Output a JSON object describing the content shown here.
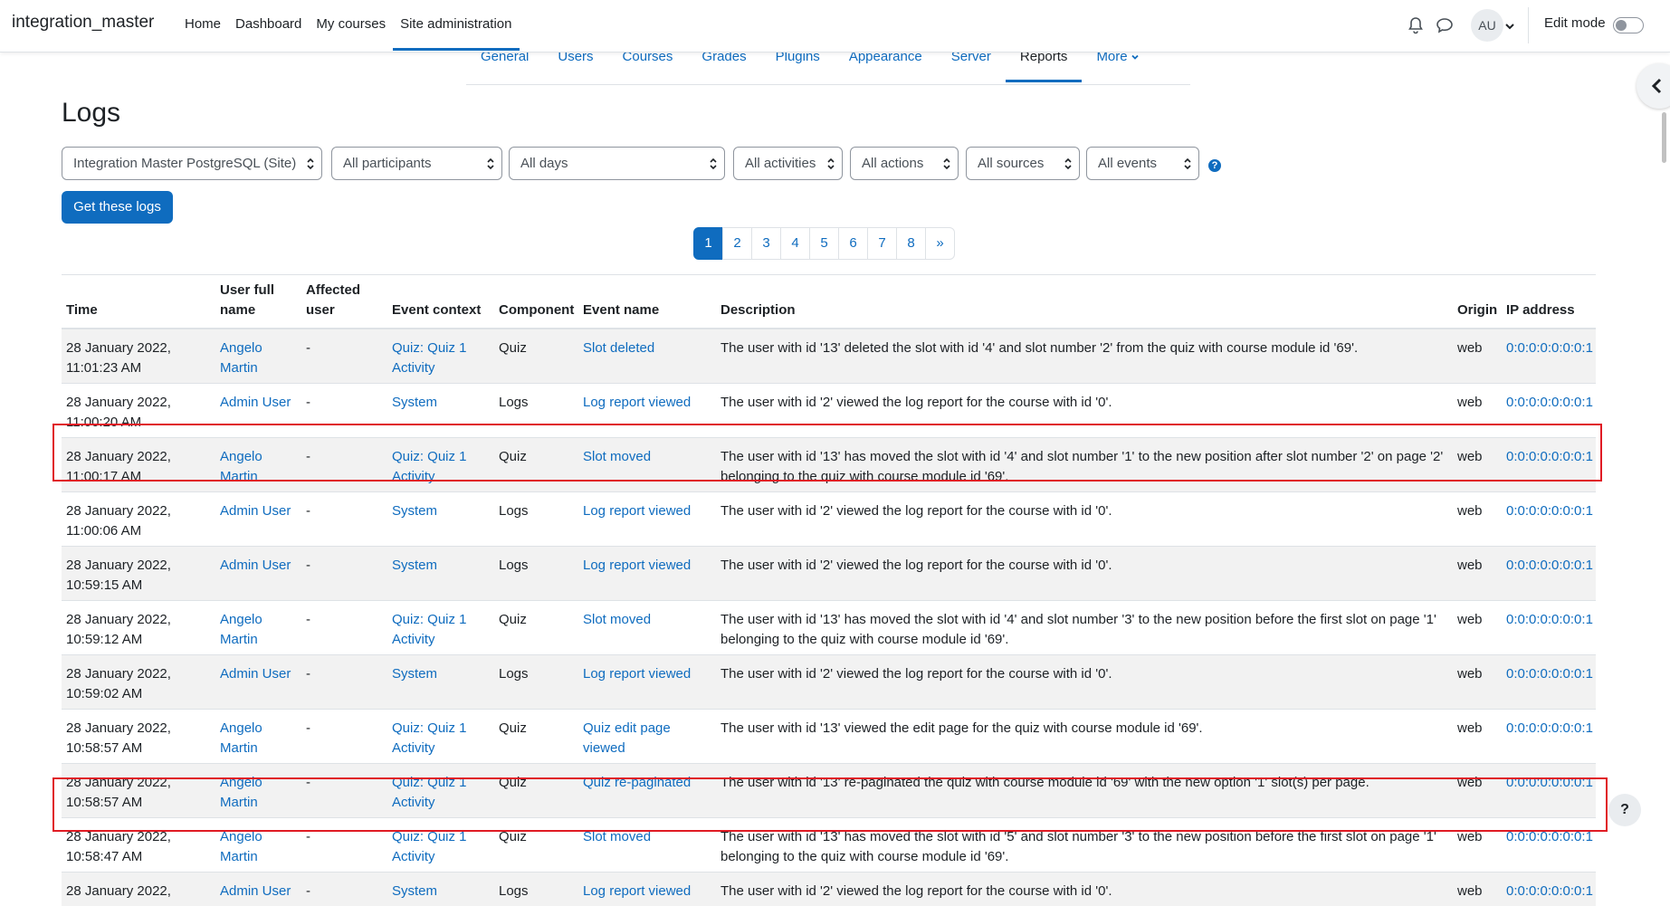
{
  "navbar": {
    "brand": "integration_master",
    "items": [
      {
        "label": "Home"
      },
      {
        "label": "Dashboard"
      },
      {
        "label": "My courses"
      },
      {
        "label": "Site administration"
      }
    ],
    "avatar_initials": "AU",
    "edit_mode_label": "Edit mode"
  },
  "secondary_nav": {
    "tabs": [
      "General",
      "Users",
      "Courses",
      "Grades",
      "Plugins",
      "Appearance",
      "Server",
      "Reports",
      "More"
    ]
  },
  "page": {
    "title": "Logs"
  },
  "filters": {
    "site": "Integration Master PostgreSQL (Site)",
    "participants": "All participants",
    "days": "All days",
    "activities": "All activities",
    "actions": "All actions",
    "sources": "All sources",
    "events": "All events",
    "help": "?"
  },
  "get_logs_button": "Get these logs",
  "pagination": [
    "1",
    "2",
    "3",
    "4",
    "5",
    "6",
    "7",
    "8",
    "»"
  ],
  "table": {
    "headers": [
      "Time",
      "User full name",
      "Affected user",
      "Event context",
      "Component",
      "Event name",
      "Description",
      "Origin",
      "IP address"
    ],
    "rows": [
      {
        "time": "28 January 2022, 11:01:23 AM",
        "user": "Angelo Martin",
        "affected": "-",
        "context": "Quiz: Quiz 1 Activity",
        "component": "Quiz",
        "event": "Slot deleted",
        "description": "The user with id '13' deleted the slot with id '4' and slot number '2' from the quiz with course module id '69'.",
        "origin": "web",
        "ip": "0:0:0:0:0:0:0:1"
      },
      {
        "time": "28 January 2022, 11:00:20 AM",
        "user": "Admin User",
        "affected": "-",
        "context": "System",
        "component": "Logs",
        "event": "Log report viewed",
        "description": "The user with id '2' viewed the log report for the course with id '0'.",
        "origin": "web",
        "ip": "0:0:0:0:0:0:0:1"
      },
      {
        "time": "28 January 2022, 11:00:17 AM",
        "user": "Angelo Martin",
        "affected": "-",
        "context": "Quiz: Quiz 1 Activity",
        "component": "Quiz",
        "event": "Slot moved",
        "description": "The user with id '13' has moved the slot with id '4' and slot number '1' to the new position after slot number '2' on page '2' belonging to the quiz with course module id '69'.",
        "origin": "web",
        "ip": "0:0:0:0:0:0:0:1"
      },
      {
        "time": "28 January 2022, 11:00:06 AM",
        "user": "Admin User",
        "affected": "-",
        "context": "System",
        "component": "Logs",
        "event": "Log report viewed",
        "description": "The user with id '2' viewed the log report for the course with id '0'.",
        "origin": "web",
        "ip": "0:0:0:0:0:0:0:1"
      },
      {
        "time": "28 January 2022, 10:59:15 AM",
        "user": "Admin User",
        "affected": "-",
        "context": "System",
        "component": "Logs",
        "event": "Log report viewed",
        "description": "The user with id '2' viewed the log report for the course with id '0'.",
        "origin": "web",
        "ip": "0:0:0:0:0:0:0:1"
      },
      {
        "time": "28 January 2022, 10:59:12 AM",
        "user": "Angelo Martin",
        "affected": "-",
        "context": "Quiz: Quiz 1 Activity",
        "component": "Quiz",
        "event": "Slot moved",
        "description": "The user with id '13' has moved the slot with id '4' and slot number '3' to the new position before the first slot on page '1' belonging to the quiz with course module id '69'.",
        "origin": "web",
        "ip": "0:0:0:0:0:0:0:1"
      },
      {
        "time": "28 January 2022, 10:59:02 AM",
        "user": "Admin User",
        "affected": "-",
        "context": "System",
        "component": "Logs",
        "event": "Log report viewed",
        "description": "The user with id '2' viewed the log report for the course with id '0'.",
        "origin": "web",
        "ip": "0:0:0:0:0:0:0:1"
      },
      {
        "time": "28 January 2022, 10:58:57 AM",
        "user": "Angelo Martin",
        "affected": "-",
        "context": "Quiz: Quiz 1 Activity",
        "component": "Quiz",
        "event": "Quiz edit page viewed",
        "description": "The user with id '13' viewed the edit page for the quiz with course module id '69'.",
        "origin": "web",
        "ip": "0:0:0:0:0:0:0:1"
      },
      {
        "time": "28 January 2022, 10:58:57 AM",
        "user": "Angelo Martin",
        "affected": "-",
        "context": "Quiz: Quiz 1 Activity",
        "component": "Quiz",
        "event": "Quiz re-paginated",
        "description": "The user with id '13' re-paginated the quiz with course module id '69' with the new option '1' slot(s) per page.",
        "origin": "web",
        "ip": "0:0:0:0:0:0:0:1"
      },
      {
        "time": "28 January 2022, 10:58:47 AM",
        "user": "Angelo Martin",
        "affected": "-",
        "context": "Quiz: Quiz 1 Activity",
        "component": "Quiz",
        "event": "Slot moved",
        "description": "The user with id '13' has moved the slot with id '5' and slot number '3' to the new position before the first slot on page '1' belonging to the quiz with course module id '69'.",
        "origin": "web",
        "ip": "0:0:0:0:0:0:0:1"
      },
      {
        "time": "28 January 2022,",
        "user": "Admin User",
        "affected": "-",
        "context": "System",
        "component": "Logs",
        "event": "Log report viewed",
        "description": "The user with id '2' viewed the log report for the course with id '0'.",
        "origin": "web",
        "ip": "0:0:0:0:0:0:0:1"
      }
    ]
  },
  "help_button": "?",
  "colors": {
    "link": "#0f6cbf",
    "highlight": "#e01b24",
    "stripe": "#f2f2f2"
  }
}
